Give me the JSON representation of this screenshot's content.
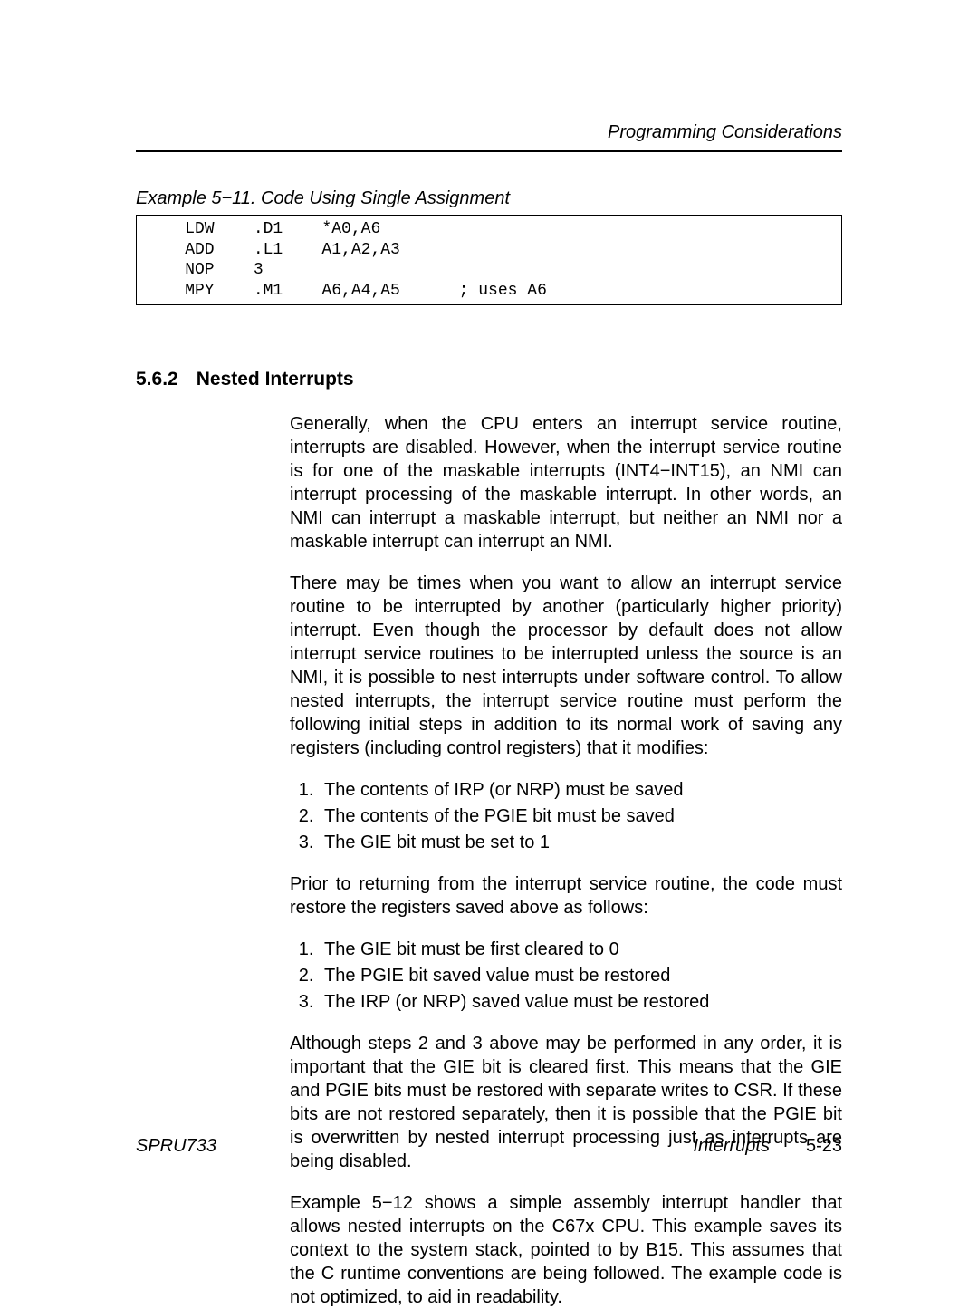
{
  "header": {
    "running_title": "Programming Considerations"
  },
  "example": {
    "caption": "Example 5−11. Code Using Single Assignment",
    "code": "    LDW    .D1    *A0,A6\n    ADD    .L1    A1,A2,A3\n    NOP    3\n    MPY    .M1    A6,A4,A5      ; uses A6"
  },
  "section": {
    "number": "5.6.2",
    "title": "Nested Interrupts",
    "para1": "Generally, when the CPU enters an interrupt service routine, interrupts are disabled. However, when the interrupt service routine is for one of the maskable interrupts (INT4−INT15), an NMI can interrupt processing of the maskable interrupt. In other words, an NMI can interrupt a maskable interrupt, but neither an NMI nor a maskable interrupt can interrupt an NMI.",
    "para2": "There may be times when you want to allow an interrupt service routine to be interrupted by another (particularly higher priority) interrupt. Even though the processor by default does not allow interrupt service routines to be interrupted unless the source is an NMI, it is possible to nest interrupts under software control. To allow nested interrupts, the interrupt service routine must perform the following initial steps in addition to its normal work of saving any registers (including control registers) that it modifies:",
    "list1": [
      "The contents of IRP (or NRP) must be saved",
      "The contents of the PGIE bit must be saved",
      "The GIE bit must be set to 1"
    ],
    "para3": "Prior to returning from the interrupt service routine, the code must restore the registers saved above as follows:",
    "list2": [
      "The GIE bit must be first cleared to 0",
      "The PGIE bit saved value must be restored",
      "The IRP (or NRP) saved value must be restored"
    ],
    "para4": "Although steps 2 and 3 above may be performed in any order, it is important that the GIE bit is cleared first. This means that the GIE and PGIE bits must be restored with separate writes to CSR. If these bits are not restored separately, then it is possible that the PGIE bit is overwritten by nested interrupt processing just as interrupts are being disabled.",
    "para5": "Example 5−12 shows a simple assembly interrupt handler that allows nested interrupts on the C67x CPU. This example saves its context to the system stack, pointed to by B15. This assumes that the C runtime conventions are being followed. The example code is not optimized, to aid in readability."
  },
  "footer": {
    "doc_id": "SPRU733",
    "chapter": "Interrupts",
    "page": "5-23"
  }
}
